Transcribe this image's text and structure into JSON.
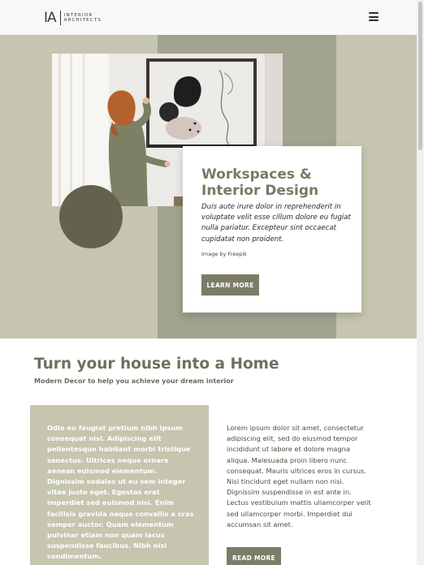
{
  "header": {
    "logo_mark": "IA",
    "logo_line1": "INTERIOR",
    "logo_line2": "ARCHITECTS",
    "menu_icon": "hamburger-menu-icon"
  },
  "hero": {
    "title_line1": "Workspaces &",
    "title_line2": "Interior Design",
    "description": "Duis aute irure dolor in reprehenderit in voluptate velit esse cillum dolore eu fugiat nulla pariatur. Excepteur sint occaecat cupidatat non proident.",
    "credit": "Image by Freepik",
    "button_label": "LEARN MORE"
  },
  "intro": {
    "title": "Turn your house into a Home",
    "subtitle": "Modern Decor to help you achieve your dream interior",
    "box_text": "Odio eu feugiat pretium nibh ipsum consequat nisl. Adipiscing elit pellentesque habitant morbi tristique senectus. Ultrices neque ornare aenean euismod elementum. Dignissim sodales ut eu sem integer vitae justo eget. Egestas erat imperdiet sed euismod nisi. Enim facilisis gravida neque convallis a cras semper auctor. Quam elementum pulvinar etiam non quam lacus suspendisse faucibus. Nibh nisl condimentum.",
    "body_text": "Lorem ipsum dolor sit amet, consectetur adipiscing elit, sed do eiusmod tempor incididunt ut labore et dolore magna aliqua. Malesuada proin libero nunc consequat. Mauris ultrices eros in cursus. Nisl tincidunt eget nullam non nisi. Dignissim suspendisse in est ante in. Lectus vestibulum mattis ullamcorper velit sed ullamcorper morbi. Imperdiet dui accumsan sit amet.",
    "button_label": "READ MORE"
  },
  "colors": {
    "accent": "#7c7c68",
    "sage": "#c5c5b0",
    "band": "#a2a390",
    "circle": "#62624f"
  }
}
